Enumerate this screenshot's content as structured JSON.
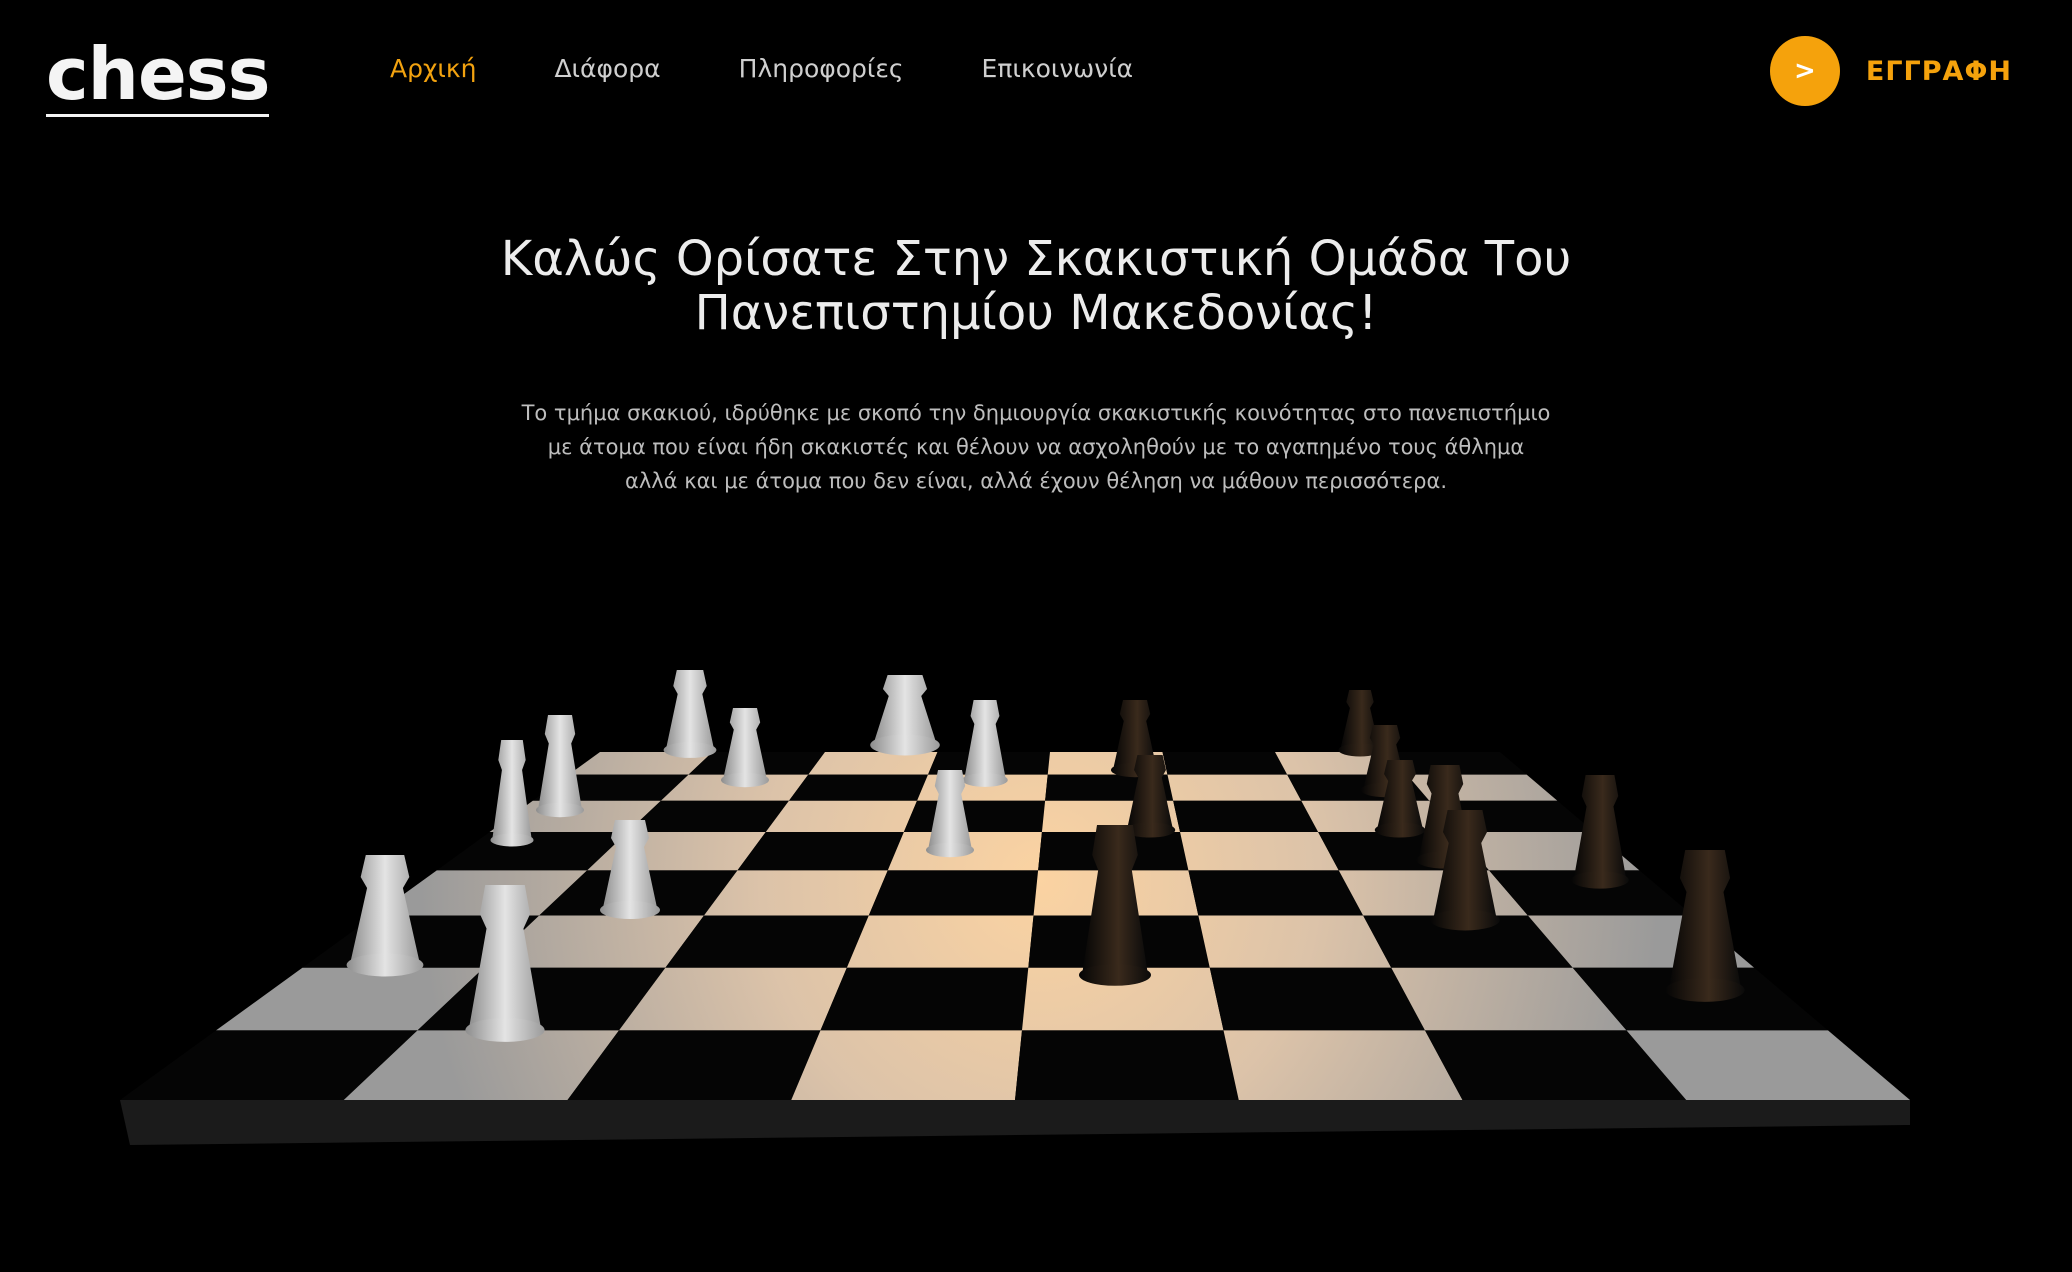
{
  "header": {
    "logo": "chess",
    "nav": [
      {
        "label": "Αρχική",
        "active": true
      },
      {
        "label": "Διάφορα",
        "active": false
      },
      {
        "label": "Πληροφορίες",
        "active": false
      },
      {
        "label": "Επικοινωνία",
        "active": false
      }
    ],
    "cta": {
      "icon": ">",
      "label": "ΕΓΓΡΑΦΗ"
    }
  },
  "hero": {
    "title_lines": [
      "Καλώς Ορίσατε Στην Σκακιστική Ομάδα Του",
      "Πανεπιστημίου Μακεδονίας!"
    ],
    "description_lines": [
      "Το τμήμα σκακιού, ιδρύθηκε με σκοπό την δημιουργία σκακιστικής κοινότητας στο πανεπιστήμιο",
      "με άτομα που είναι ήδη σκακιστές και θέλουν να ασχοληθούν με το αγαπημένο τους άθλημα",
      "αλλά και με άτομα που δεν είναι, αλλά έχουν θέληση να μάθουν περισσότερα."
    ]
  },
  "colors": {
    "accent": "#f5a20c",
    "background": "#000000"
  }
}
